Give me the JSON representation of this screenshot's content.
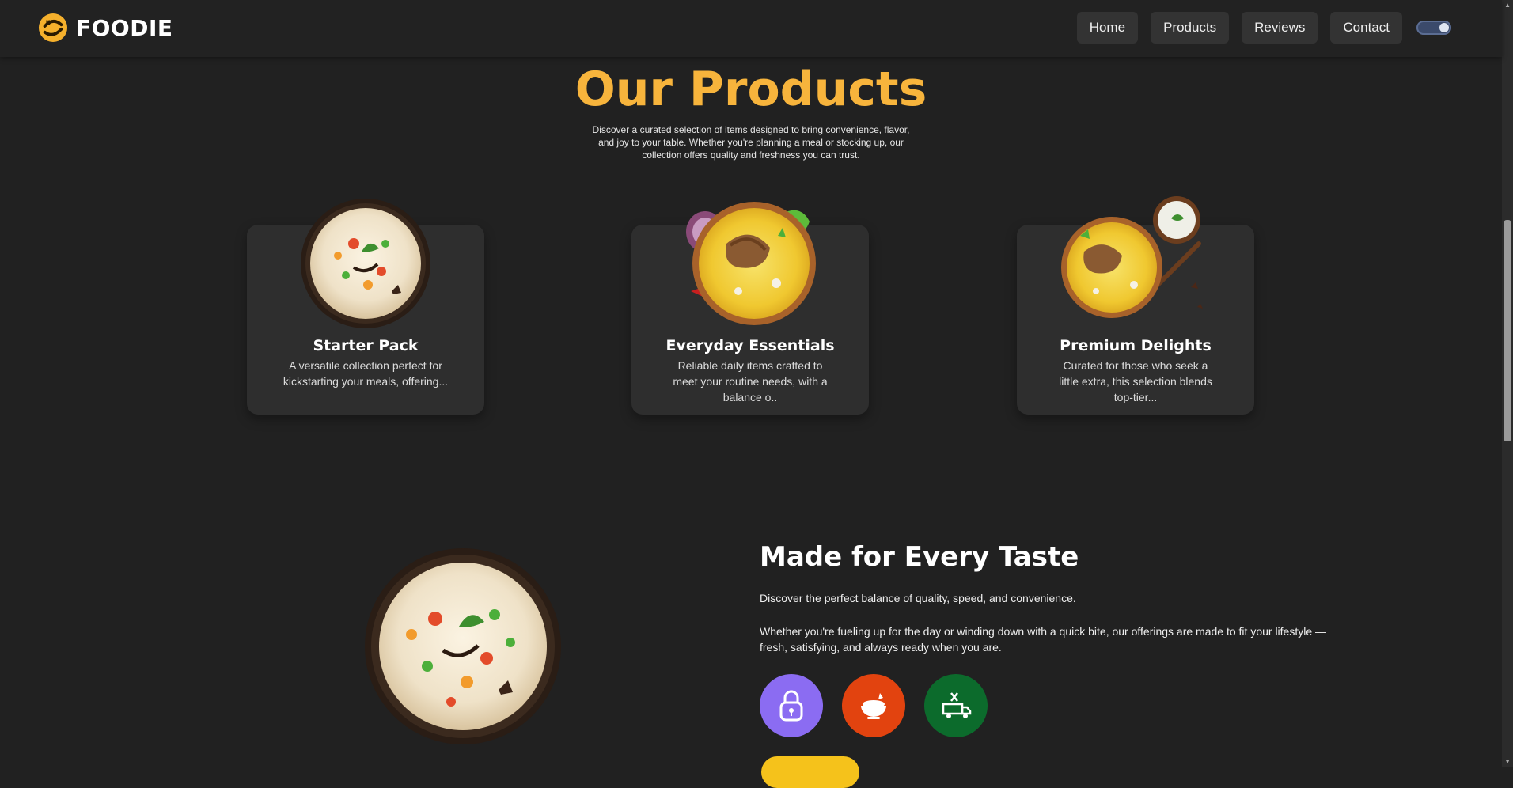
{
  "brand": {
    "name": "FOODIE",
    "accent": "#f7b43c"
  },
  "nav": {
    "items": [
      "Home",
      "Products",
      "Reviews",
      "Contact"
    ],
    "theme_toggle": "dark-mode-toggle"
  },
  "products": {
    "title": "Our Products",
    "description": "Discover a curated selection of items designed to bring convenience, flavor, and joy to your table. Whether you're planning a meal or stocking up, our collection offers quality and freshness you can trust.",
    "cards": [
      {
        "title": "Starter Pack",
        "desc": "A versatile collection perfect for kickstarting your meals, offering...",
        "image": "biryani-bowl-image"
      },
      {
        "title": "Everyday Essentials",
        "desc": "Reliable daily items crafted to meet your routine needs, with a balance o..",
        "image": "chicken-biryani-image"
      },
      {
        "title": "Premium Delights",
        "desc": "Curated for those who seek a little extra, this selection blends top-tier...",
        "image": "biryani-raita-image"
      }
    ]
  },
  "taste": {
    "title": "Made for Every Taste",
    "p1": "Discover the perfect balance of quality, speed, and convenience.",
    "p2": "Whether you're fueling up for the day or winding down with a quick bite, our offerings are made to fit your lifestyle — fresh, satisfying, and always ready when you are.",
    "features": [
      {
        "icon": "padlock-icon",
        "color": "#8b6cf2"
      },
      {
        "icon": "food-bowl-icon",
        "color": "#e2430f"
      },
      {
        "icon": "food-truck-icon",
        "color": "#0c6b2c"
      }
    ],
    "cta_color": "#f5c21b"
  }
}
